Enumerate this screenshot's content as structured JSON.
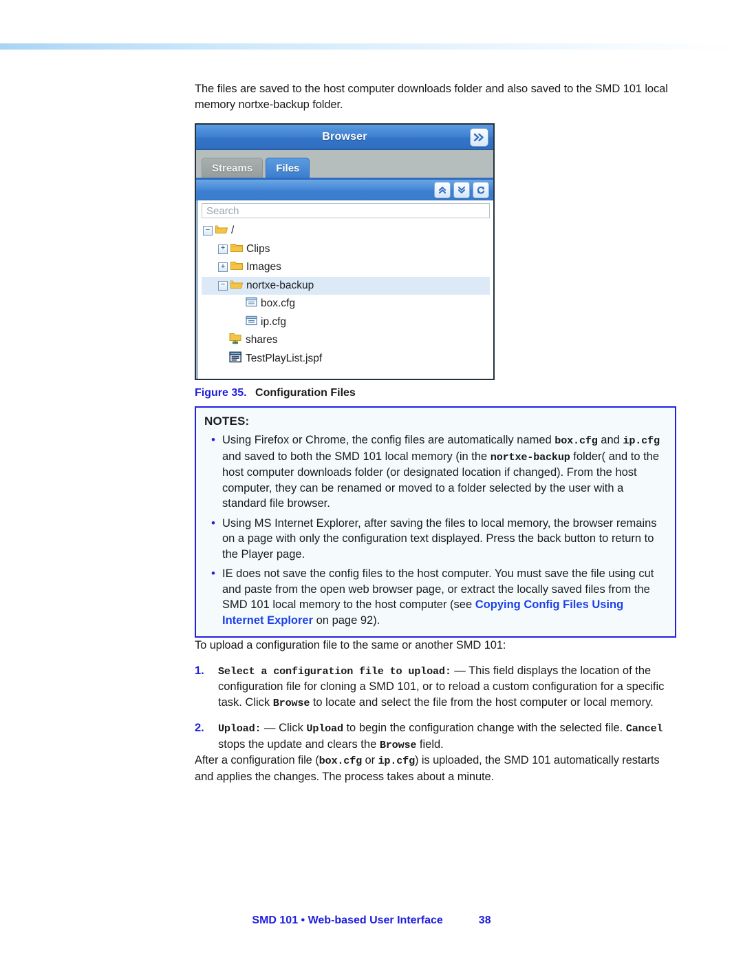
{
  "intro": {
    "paragraph": "The files are saved to the host computer downloads folder and also saved to the SMD 101 local memory nortxe-backup folder."
  },
  "browser_panel": {
    "title": "Browser",
    "expand_button_icon": "double-chevron-right-icon",
    "tabs": [
      {
        "label": "Streams",
        "active": false
      },
      {
        "label": "Files",
        "active": true
      }
    ],
    "toolbar_buttons": [
      {
        "icon": "collapse-all-icon",
        "name": "collapse-all-button"
      },
      {
        "icon": "expand-all-icon",
        "name": "expand-all-button"
      },
      {
        "icon": "refresh-icon",
        "name": "refresh-button"
      }
    ],
    "search": {
      "placeholder": "Search",
      "value": ""
    },
    "tree": [
      {
        "label": "/",
        "type": "folder-open",
        "toggle": "-",
        "depth": 0,
        "selected": false
      },
      {
        "label": "Clips",
        "type": "folder-closed",
        "toggle": "+",
        "depth": 1,
        "selected": false
      },
      {
        "label": "Images",
        "type": "folder-closed",
        "toggle": "+",
        "depth": 1,
        "selected": false
      },
      {
        "label": "nortxe-backup",
        "type": "folder-open",
        "toggle": "-",
        "depth": 1,
        "selected": true
      },
      {
        "label": "box.cfg",
        "type": "config-file",
        "toggle": "",
        "depth": 2,
        "selected": false
      },
      {
        "label": "ip.cfg",
        "type": "config-file",
        "toggle": "",
        "depth": 2,
        "selected": false
      },
      {
        "label": "shares",
        "type": "folder-shared",
        "toggle": "",
        "depth": 1,
        "selected": false
      },
      {
        "label": "TestPlayList.jspf",
        "type": "playlist-file",
        "toggle": "",
        "depth": 1,
        "selected": false
      }
    ]
  },
  "figure": {
    "number": "Figure 35.",
    "caption": "Configuration Files"
  },
  "notes": {
    "title": "NOTES:",
    "bullet": "•",
    "items": [
      {
        "segments": [
          {
            "text": "Using Firefox or Chrome, the config files are automatically named ",
            "style": "normal"
          },
          {
            "text": "box.cfg",
            "style": "mono"
          },
          {
            "text": " and ",
            "style": "normal"
          },
          {
            "text": "ip.cfg",
            "style": "mono"
          },
          {
            "text": " and saved to both the SMD 101 local memory (in the ",
            "style": "normal"
          },
          {
            "text": "nortxe-backup",
            "style": "mono"
          },
          {
            "text": " folder( and to the host computer downloads folder (or designated location if changed). From the host computer, they can be renamed or moved to a folder selected by the user with a standard file browser.",
            "style": "normal"
          }
        ]
      },
      {
        "segments": [
          {
            "text": "Using MS Internet Explorer, after saving the files to local memory, the browser remains on a page with only the configuration text displayed. Press the back button to return to the Player page.",
            "style": "normal"
          }
        ]
      },
      {
        "segments": [
          {
            "text": "IE does not save the config files to the host computer. You must save the file using cut and paste from the open web browser page, or extract the locally saved files from the SMD 101 local memory to the host computer (see ",
            "style": "normal"
          },
          {
            "text": "Copying Config Files Using Internet Explorer",
            "style": "link"
          },
          {
            "text": " on page 92).",
            "style": "normal"
          }
        ]
      }
    ]
  },
  "upload_section": {
    "lead_in": "To upload a configuration file to the same or another SMD 101:",
    "steps": [
      {
        "number": "1.",
        "segments": [
          {
            "text": "Select a configuration file to upload:",
            "style": "mono"
          },
          {
            "text": " — This field displays the location of the configuration file for cloning a SMD 101, or to reload a custom configuration for a specific task. Click ",
            "style": "normal"
          },
          {
            "text": "Browse",
            "style": "mono"
          },
          {
            "text": " to locate and select the file from the host computer or local memory.",
            "style": "normal"
          }
        ]
      },
      {
        "number": "2.",
        "segments": [
          {
            "text": "Upload:",
            "style": "mono"
          },
          {
            "text": " — Click ",
            "style": "normal"
          },
          {
            "text": "Upload",
            "style": "mono"
          },
          {
            "text": " to begin the configuration change with the selected file. ",
            "style": "normal"
          },
          {
            "text": "Cancel",
            "style": "mono"
          },
          {
            "text": " stops the update and clears the ",
            "style": "normal"
          },
          {
            "text": "Browse",
            "style": "mono"
          },
          {
            "text": " field.",
            "style": "normal"
          }
        ]
      }
    ],
    "closing": {
      "segments": [
        {
          "text": "After a configuration file (",
          "style": "normal"
        },
        {
          "text": "box.cfg",
          "style": "mono"
        },
        {
          "text": " or ",
          "style": "normal"
        },
        {
          "text": "ip.cfg",
          "style": "mono"
        },
        {
          "text": ") is uploaded, the SMD 101 automatically restarts and applies the changes. The process takes about a minute.",
          "style": "normal"
        }
      ]
    }
  },
  "footer": {
    "text": "SMD 101 • Web-based User Interface",
    "page_number": "38"
  },
  "colors": {
    "accent_blue": "#1c1ce0",
    "link_blue": "#1c3fe8",
    "panel_blue": "#3576c9",
    "selection_blue": "#dceaf8"
  }
}
